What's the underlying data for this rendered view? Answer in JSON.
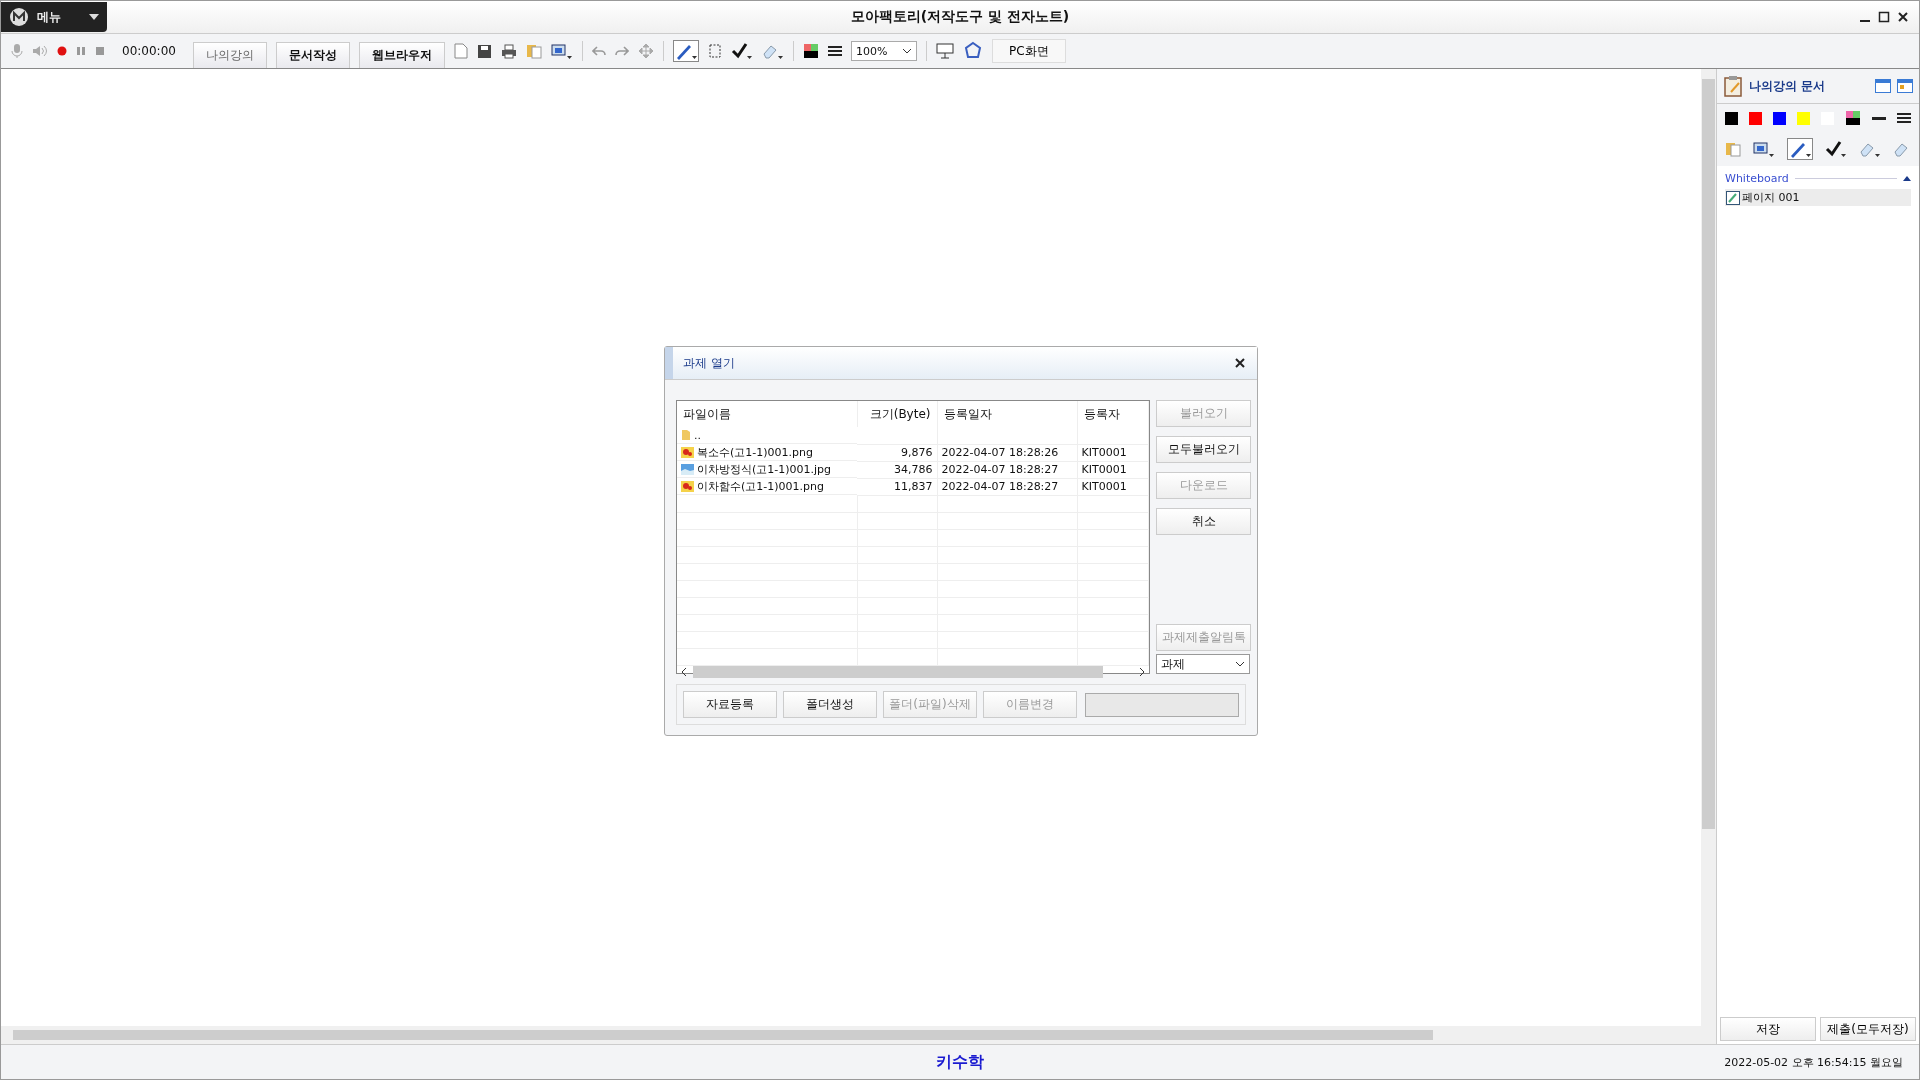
{
  "window": {
    "menu": "메뉴",
    "title": "모아팩토리(저작도구 및 전자노트)"
  },
  "toolbar": {
    "timer": "00:00:00",
    "tabs": [
      {
        "label": "나의강의",
        "disabled": true
      },
      {
        "label": "문서작성",
        "disabled": false
      },
      {
        "label": "웹브라우저",
        "disabled": false
      }
    ],
    "zoom": "100%",
    "pc_button": "PC화면"
  },
  "dialog": {
    "title": "과제 열기",
    "columns": [
      "파일이름",
      "크기(Byte)",
      "등록일자",
      "등록자"
    ],
    "rows": [
      {
        "kind": "folder",
        "name": "..",
        "size": "",
        "date": "",
        "owner": ""
      },
      {
        "kind": "image",
        "name": "복소수(고1-1)001.png",
        "size": "9,876",
        "date": "2022-04-07 18:28:26",
        "owner": "KIT0001"
      },
      {
        "kind": "photo",
        "name": "이차방정식(고1-1)001.jpg",
        "size": "34,786",
        "date": "2022-04-07 18:28:27",
        "owner": "KIT0001"
      },
      {
        "kind": "image",
        "name": "이차함수(고1-1)001.png",
        "size": "11,837",
        "date": "2022-04-07 18:28:27",
        "owner": "KIT0001"
      }
    ],
    "side_buttons": [
      {
        "label": "불러오기",
        "disabled": true
      },
      {
        "label": "모두불러오기",
        "disabled": false
      },
      {
        "label": "다운로드",
        "disabled": true
      },
      {
        "label": "취소",
        "disabled": false
      }
    ],
    "notify_button": {
      "label": "과제제출알림톡",
      "disabled": true
    },
    "category": "과제",
    "bottom_buttons": [
      {
        "label": "자료등록",
        "disabled": false
      },
      {
        "label": "폴더생성",
        "disabled": false
      },
      {
        "label": "폴더(파일)삭제",
        "disabled": true
      },
      {
        "label": "이름변경",
        "disabled": true
      }
    ]
  },
  "panel": {
    "title": "나의강의 문서",
    "colors": [
      {
        "color": "#000000"
      },
      {
        "color": "#ff0000"
      },
      {
        "color": "#0000ff"
      },
      {
        "color": "#ffff00"
      },
      {
        "color": "#ffffff"
      }
    ],
    "section": "Whiteboard",
    "pages": [
      {
        "label": "페이지 001",
        "selected": true
      }
    ],
    "buttons": [
      "저장",
      "제출(모두저장)"
    ]
  },
  "status_bar": {
    "center": "키수학",
    "datetime": "2022-05-02 오후 16:54:15 월요일"
  }
}
